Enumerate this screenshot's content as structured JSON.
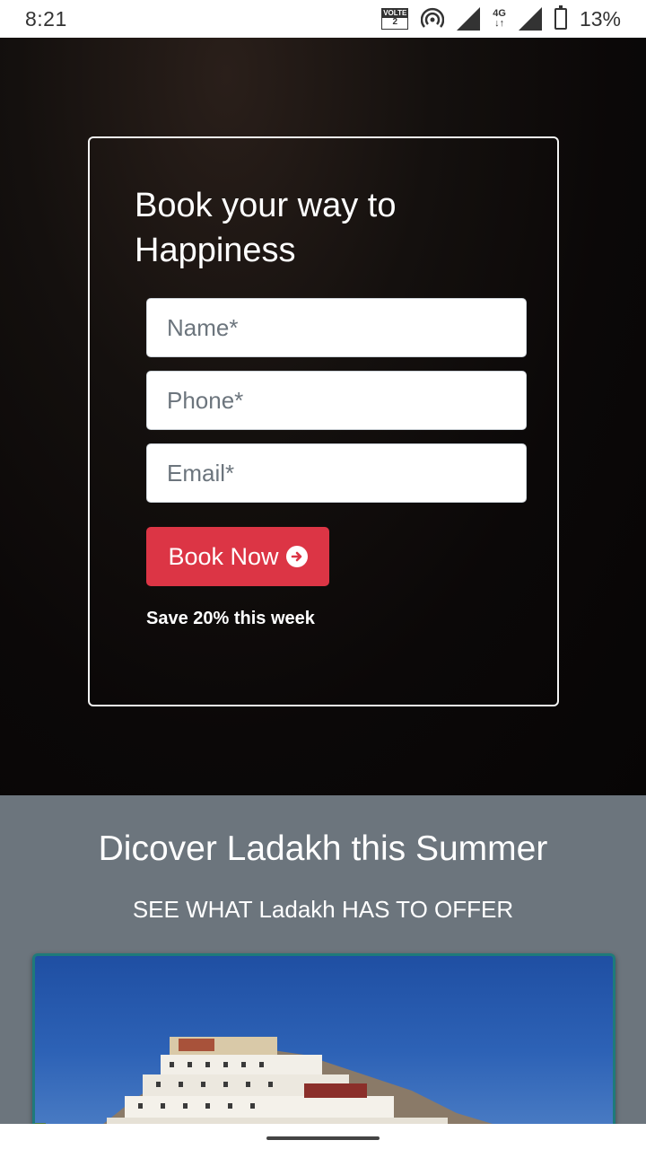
{
  "status_bar": {
    "time": "8:21",
    "volte_top": "VOLTE",
    "volte_bottom": "2",
    "network": "4G",
    "battery_pct": "13%",
    "icons": [
      "volte-icon",
      "hotspot-icon",
      "signal-icon",
      "network-4g-icon",
      "signal-icon",
      "battery-icon"
    ]
  },
  "booking_form": {
    "title": "Book your way to Happiness",
    "name_placeholder": "Name*",
    "phone_placeholder": "Phone*",
    "email_placeholder": "Email*",
    "submit_label": "Book Now",
    "submit_icon": "arrow-circle-right-icon",
    "save_note": "Save 20% this week"
  },
  "discover": {
    "title": "Dicover Ladakh this Summer",
    "subtitle": "SEE WHAT Ladakh HAS TO OFFER"
  },
  "colors": {
    "accent": "#dc3545",
    "section_bg": "#6c757d",
    "hero_bg": "#0b0808"
  }
}
